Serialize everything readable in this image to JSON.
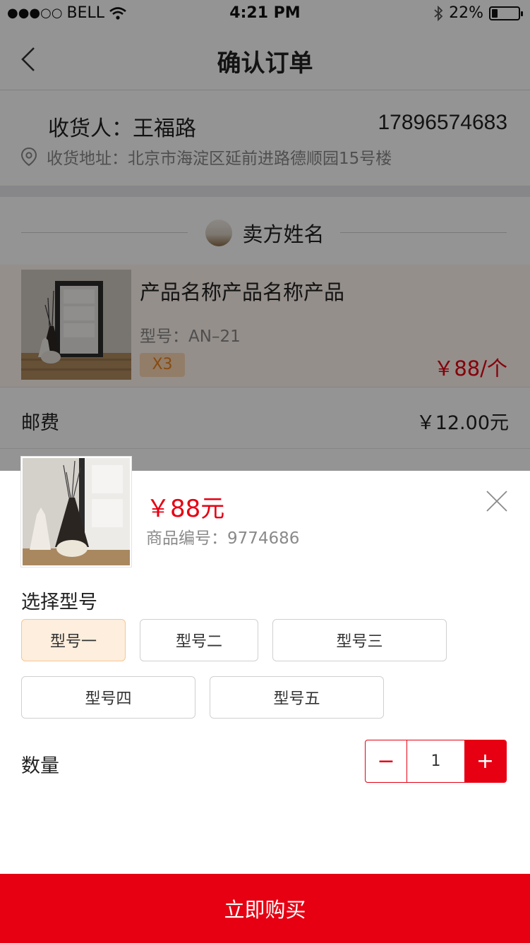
{
  "status_bar": {
    "carrier": "BELL",
    "time": "4:21 PM",
    "battery": "22%",
    "battery_level": 0.22,
    "icons": [
      "signal-dots-icon",
      "wifi-icon",
      "bluetooth-icon",
      "battery-icon"
    ]
  },
  "nav": {
    "title": "确认订单",
    "back_icon": "chevron-left-icon"
  },
  "consignee": {
    "label": "收货人：",
    "name": "王福路",
    "phone": "17896574683",
    "address_label": "收货地址：",
    "address": "北京市海淀区延前进路德顺园15号楼",
    "address_icon": "location-pin-icon"
  },
  "seller": {
    "name": "卖方姓名"
  },
  "product": {
    "name": "产品名称产品名称产品",
    "model": "型号：AN–21",
    "qty_badge": "X3",
    "price": "￥88/个"
  },
  "postage": {
    "label": "邮费",
    "value": "￥12.00元"
  },
  "sheet": {
    "price": "￥88元",
    "code": "商品编号：9774686",
    "close_icon": "close-icon",
    "model_section_label": "选择型号",
    "models": [
      {
        "label": "型号一",
        "selected": true
      },
      {
        "label": "型号二",
        "selected": false
      },
      {
        "label": "型号三",
        "selected": false
      },
      {
        "label": "型号四",
        "selected": false
      },
      {
        "label": "型号五",
        "selected": false
      }
    ],
    "qty_label": "数量",
    "qty": {
      "minus": "−",
      "value": "1",
      "plus": "+"
    },
    "buy_button": "立即购买"
  },
  "colors": {
    "accent": "#e60012",
    "selected_bg": "#fdeedd",
    "selected_border": "#f6c792",
    "badge_bg": "#fbd7b3",
    "badge_text": "#e8821e"
  }
}
